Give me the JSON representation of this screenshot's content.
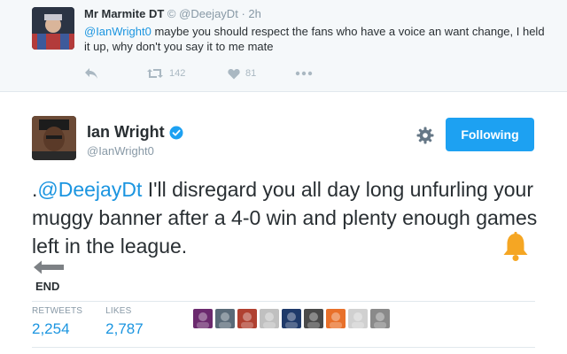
{
  "reply": {
    "author_name": "Mr Marmite DT",
    "author_flag": "©",
    "author_handle": "@DeejayDt",
    "time": "· 2h",
    "mention": "@IanWright0",
    "text": " maybe you should respect the fans who have a voice an want change, I held it up, why don't you say it to me mate",
    "retweets": "142",
    "likes": "81"
  },
  "tweet": {
    "author_name": "Ian Wright",
    "author_handle": "@IanWright0",
    "follow_label": "Following",
    "text_prefix": ".",
    "mention": "@DeejayDt",
    "text": " I'll disregard you all day long unfurling your muggy banner after a 4-0 win and plenty enough games left in the league.",
    "end_label": "END",
    "retweets_label": "RETWEETS",
    "retweets_count": "2,254",
    "likes_label": "LIKES",
    "likes_count": "2,787",
    "liker_colors": [
      "#6b2a6e",
      "#5a6a78",
      "#b04030",
      "#c0c0c0",
      "#1f3a6a",
      "#4a4a4a",
      "#e8702a",
      "#d0d0d0",
      "#8a8a8a"
    ]
  },
  "colors": {
    "accent": "#1da1f2",
    "link": "#1b95e0",
    "bell": "#f5a623",
    "verified": "#1da1f2"
  }
}
